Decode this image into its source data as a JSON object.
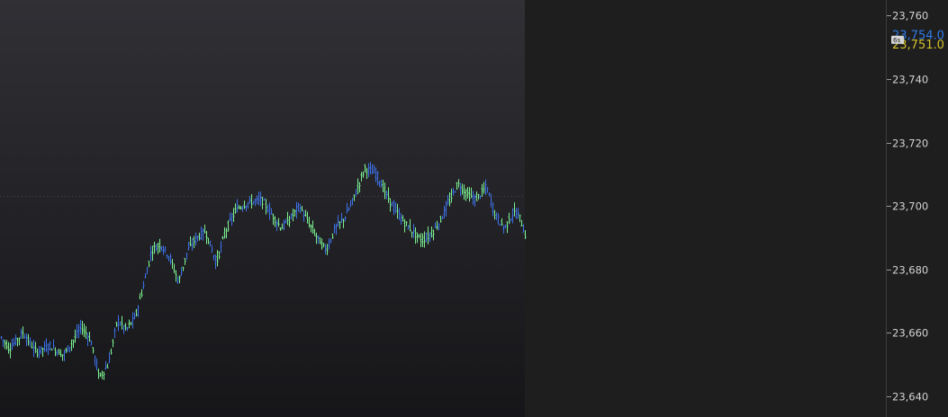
{
  "chart_data": {
    "type": "ohlc-bar",
    "xlabel": "",
    "ylabel": "",
    "ylim": [
      23633.5,
      23764.9
    ],
    "grid": false,
    "y_ticks": [
      {
        "value": 23760,
        "label": "23,760"
      },
      {
        "value": 23740,
        "label": "23,740"
      },
      {
        "value": 23720,
        "label": "23,720"
      },
      {
        "value": 23700,
        "label": "23,700"
      },
      {
        "value": 23680,
        "label": "23,680"
      },
      {
        "value": 23660,
        "label": "23,660"
      },
      {
        "value": 23640,
        "label": "23,640"
      }
    ],
    "price_tags": [
      {
        "name": "last-price",
        "value": 23754,
        "label": "23,754.0",
        "color": "#2f7be8"
      },
      {
        "name": "reference-price",
        "value": 23751,
        "label": "23,751.0",
        "color": "#d3c12a"
      }
    ],
    "timer_badge": "6s",
    "up_color": "#3c6fe6",
    "down_color": "#7bef8f",
    "anchors": [
      [
        0,
        23659
      ],
      [
        10,
        23655
      ],
      [
        25,
        23660
      ],
      [
        40,
        23654
      ],
      [
        55,
        23656
      ],
      [
        70,
        23653
      ],
      [
        82,
        23658
      ],
      [
        90,
        23662
      ],
      [
        100,
        23658
      ],
      [
        110,
        23646
      ],
      [
        120,
        23650
      ],
      [
        130,
        23664
      ],
      [
        140,
        23661
      ],
      [
        150,
        23665
      ],
      [
        160,
        23676
      ],
      [
        168,
        23686
      ],
      [
        178,
        23688
      ],
      [
        188,
        23684
      ],
      [
        198,
        23676
      ],
      [
        208,
        23686
      ],
      [
        218,
        23690
      ],
      [
        228,
        23692
      ],
      [
        240,
        23682
      ],
      [
        250,
        23692
      ],
      [
        262,
        23699
      ],
      [
        275,
        23701
      ],
      [
        290,
        23702
      ],
      [
        300,
        23698
      ],
      [
        312,
        23693
      ],
      [
        322,
        23696
      ],
      [
        332,
        23700
      ],
      [
        342,
        23695
      ],
      [
        352,
        23690
      ],
      [
        362,
        23686
      ],
      [
        372,
        23693
      ],
      [
        382,
        23696
      ],
      [
        392,
        23702
      ],
      [
        405,
        23712
      ],
      [
        418,
        23710
      ],
      [
        428,
        23704
      ],
      [
        438,
        23699
      ],
      [
        448,
        23695
      ],
      [
        458,
        23692
      ],
      [
        468,
        23689
      ],
      [
        478,
        23691
      ],
      [
        488,
        23695
      ],
      [
        498,
        23701
      ],
      [
        508,
        23707
      ],
      [
        518,
        23704
      ],
      [
        528,
        23702
      ],
      [
        540,
        23706
      ],
      [
        550,
        23697
      ],
      [
        560,
        23693
      ],
      [
        570,
        23698
      ],
      [
        576,
        23697
      ],
      [
        583,
        23691
      ]
    ]
  }
}
